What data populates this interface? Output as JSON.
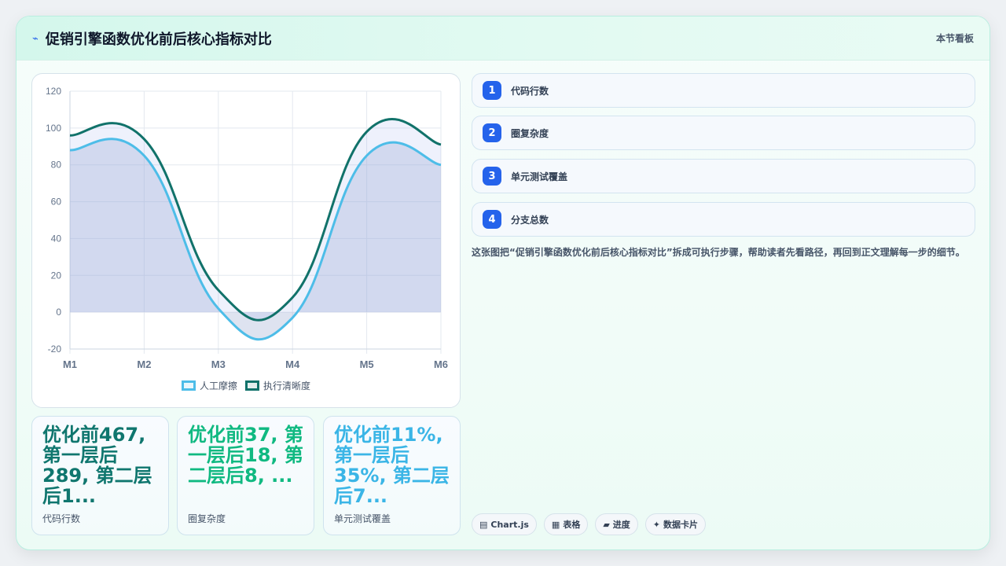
{
  "header": {
    "icon": "lightning-icon",
    "title": "促销引擎函数优化前后核心指标对比",
    "board_label": "本节看板"
  },
  "chart_data": {
    "type": "line",
    "categories": [
      "M1",
      "M2",
      "M3",
      "M4",
      "M5",
      "M6"
    ],
    "ylim": [
      -20,
      120
    ],
    "yticks": [
      -20,
      0,
      20,
      40,
      60,
      80,
      100,
      120
    ],
    "grid": true,
    "legend_position": "bottom",
    "series": [
      {
        "name": "人工摩擦",
        "values": [
          88,
          85,
          2,
          -3,
          85,
          80
        ],
        "color": "#4dbde8",
        "fill": true
      },
      {
        "name": "执行清晰度",
        "values": [
          96,
          94,
          12,
          8,
          98,
          91
        ],
        "color": "#11726a",
        "fill": true
      }
    ]
  },
  "stats": [
    {
      "value": "优化前467, 第一层后289, 第二层后1...",
      "label": "代码行数",
      "color": "#0f766e"
    },
    {
      "value": "优化前37, 第一层后18, 第二层后8, ...",
      "label": "圈复杂度",
      "color": "#10b981"
    },
    {
      "value": "优化前11%, 第一层后35%, 第二层后7...",
      "label": "单元测试覆盖",
      "color": "#3ab5e6"
    }
  ],
  "steps": [
    {
      "num": "1",
      "label": "代码行数"
    },
    {
      "num": "2",
      "label": "圈复杂度"
    },
    {
      "num": "3",
      "label": "单元测试覆盖"
    },
    {
      "num": "4",
      "label": "分支总数"
    }
  ],
  "description": "这张图把“促销引擎函数优化前后核心指标对比”拆成可执行步骤，帮助读者先看路径，再回到正文理解每一步的细节。",
  "tags": [
    {
      "icon": "chart-icon",
      "glyph": "▤",
      "label": "Chart.js"
    },
    {
      "icon": "table-icon",
      "glyph": "▦",
      "label": "表格"
    },
    {
      "icon": "progress-icon",
      "glyph": "▰",
      "label": "进度"
    },
    {
      "icon": "sparkle-icon",
      "glyph": "✦",
      "label": "数据卡片"
    }
  ]
}
